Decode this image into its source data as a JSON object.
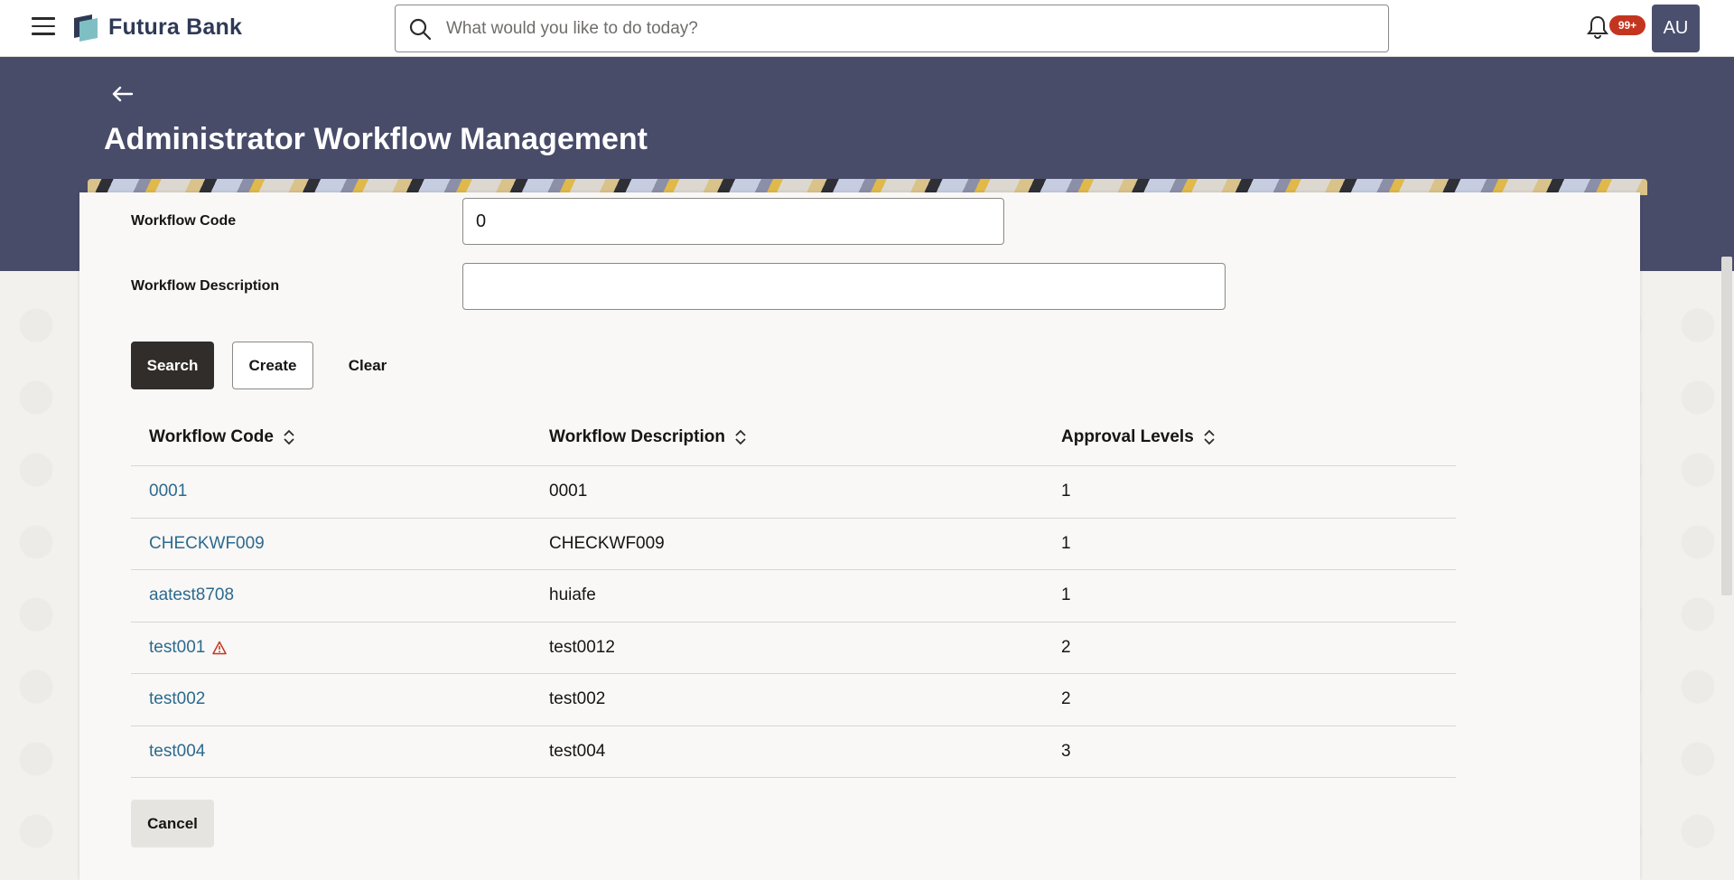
{
  "header": {
    "brand": "Futura Bank",
    "search_placeholder": "What would you like to do today?",
    "notification_count": "99+",
    "avatar_initials": "AU"
  },
  "page": {
    "title": "Administrator Workflow Management"
  },
  "form": {
    "workflow_code_label": "Workflow Code",
    "workflow_code_value": "0",
    "workflow_description_label": "Workflow Description",
    "workflow_description_value": ""
  },
  "actions": {
    "search": "Search",
    "create": "Create",
    "clear": "Clear",
    "cancel": "Cancel"
  },
  "table": {
    "columns": [
      "Workflow Code",
      "Workflow Description",
      "Approval Levels"
    ],
    "rows": [
      {
        "code": "0001",
        "description": "0001",
        "levels": "1",
        "warning": false
      },
      {
        "code": "CHECKWF009",
        "description": "CHECKWF009",
        "levels": "1",
        "warning": false
      },
      {
        "code": "aatest8708",
        "description": "huiafe",
        "levels": "1",
        "warning": false
      },
      {
        "code": "test001",
        "description": "test0012",
        "levels": "2",
        "warning": true
      },
      {
        "code": "test002",
        "description": "test002",
        "levels": "2",
        "warning": false
      },
      {
        "code": "test004",
        "description": "test004",
        "levels": "3",
        "warning": false
      }
    ]
  },
  "colors": {
    "band": "#484c69",
    "primary_button": "#312d2a",
    "link": "#2c6a8e",
    "badge": "#c4351f",
    "warning": "#c4351f"
  },
  "icons": [
    "hamburger-icon",
    "bank-logo-icon",
    "search-icon",
    "bell-icon",
    "back-arrow-icon",
    "sort-icon",
    "warning-icon"
  ]
}
